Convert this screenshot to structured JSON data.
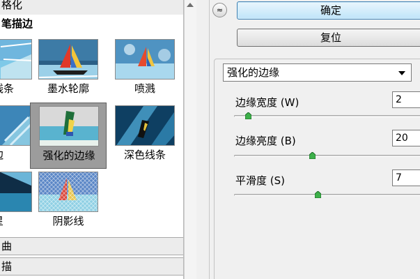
{
  "gallery": {
    "top_category": "格化",
    "open_category": "笔描边",
    "rows": [
      [
        {
          "label": "线条"
        },
        {
          "label": "墨水轮廓"
        },
        {
          "label": "喷溅"
        }
      ],
      [
        {
          "label": "边"
        },
        {
          "label": "强化的边缘"
        },
        {
          "label": "深色线条"
        }
      ],
      [
        {
          "label": "星"
        },
        {
          "label": "阴影线"
        }
      ]
    ],
    "bottom_categories": [
      "曲",
      "描"
    ]
  },
  "buttons": {
    "collapse_icon": "≈",
    "ok_label": "确定",
    "reset_label": "复位"
  },
  "filter": {
    "selected": "强化的边缘"
  },
  "params": [
    {
      "label": "边缘宽度 (W)",
      "value": "2",
      "level": 0.07
    },
    {
      "label": "边缘亮度 (B)",
      "value": "20",
      "level": 0.4
    },
    {
      "label": "平滑度 (S)",
      "value": "7",
      "level": 0.43
    }
  ],
  "colors": {
    "ok_button": "#bfe4f9",
    "selected_thumb": "#9c9c9c"
  }
}
